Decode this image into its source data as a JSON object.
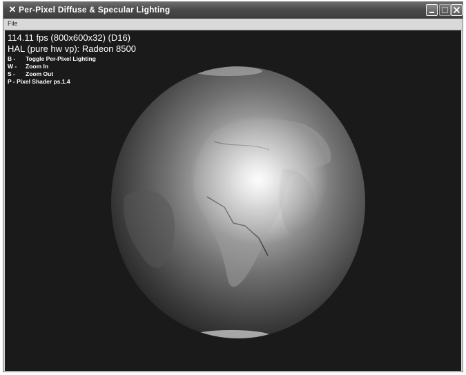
{
  "window": {
    "title": "Per-Pixel Diffuse & Specular Lighting",
    "icon": "app-x-icon",
    "controls": [
      "minimize-icon",
      "maximize-icon",
      "close-icon"
    ]
  },
  "menu": {
    "items": [
      {
        "label": "File"
      }
    ]
  },
  "stats": {
    "fps_line": "114.11 fps (800x600x32) (D16)",
    "device_line": "HAL (pure hw vp): Radeon 8500"
  },
  "help": [
    {
      "key": "B -",
      "action": "Toggle Per-Pixel Lighting"
    },
    {
      "key": "W -",
      "action": "Zoom In"
    },
    {
      "key": "S -",
      "action": "Zoom Out"
    },
    {
      "key": "P -",
      "action": "Pixel Shader ps.1.4"
    }
  ],
  "colors": {
    "background": "#1a1a1a",
    "text": "#ffffff",
    "titlebar": "#4a4a4a"
  }
}
